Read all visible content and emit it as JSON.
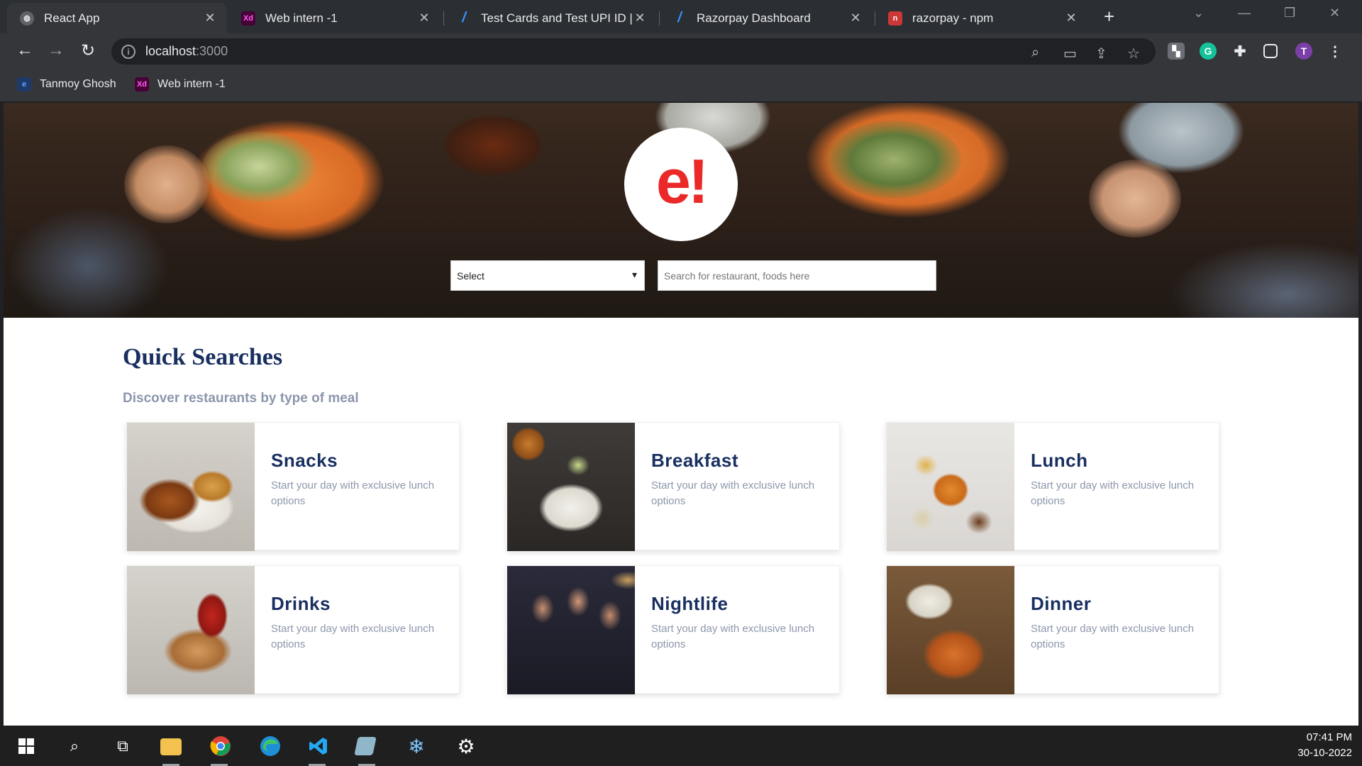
{
  "browser": {
    "tabs": [
      {
        "title": "React App",
        "icon": "react-globe-icon",
        "active": true
      },
      {
        "title": "Web intern -1",
        "icon": "adobe-xd-icon",
        "active": false
      },
      {
        "title": "Test Cards and Test UPI ID | F",
        "icon": "razorpay-icon",
        "active": false
      },
      {
        "title": "Razorpay Dashboard",
        "icon": "razorpay-icon",
        "active": false
      },
      {
        "title": "razorpay - npm",
        "icon": "npm-icon",
        "active": false
      }
    ],
    "address": {
      "host": "localhost",
      "port": ":3000"
    },
    "profile_initial": "T",
    "bookmarks": [
      {
        "label": "Tanmoy Ghosh",
        "icon": "edge-bookmark-icon"
      },
      {
        "label": "Web intern -1",
        "icon": "adobe-xd-icon"
      }
    ]
  },
  "hero": {
    "logo_text": "e!",
    "location_select": {
      "value": "Select"
    },
    "search": {
      "placeholder": "Search for restaurant, foods here"
    }
  },
  "quick_searches": {
    "title": "Quick Searches",
    "subtitle": "Discover restaurants by type of meal",
    "items": [
      {
        "name": "Snacks",
        "description": "Start your day with exclusive lunch options"
      },
      {
        "name": "Breakfast",
        "description": "Start your day with exclusive lunch options"
      },
      {
        "name": "Lunch",
        "description": "Start your day with exclusive lunch options"
      },
      {
        "name": "Drinks",
        "description": "Start your day with exclusive lunch options"
      },
      {
        "name": "Nightlife",
        "description": "Start your day with exclusive lunch options"
      },
      {
        "name": "Dinner",
        "description": "Start your day with exclusive lunch options"
      }
    ]
  },
  "taskbar": {
    "time": "07:41 PM",
    "date": "30-10-2022"
  },
  "colors": {
    "brand_red": "#eb2929",
    "heading_navy": "#192f60",
    "muted_text": "#8c96ab"
  }
}
